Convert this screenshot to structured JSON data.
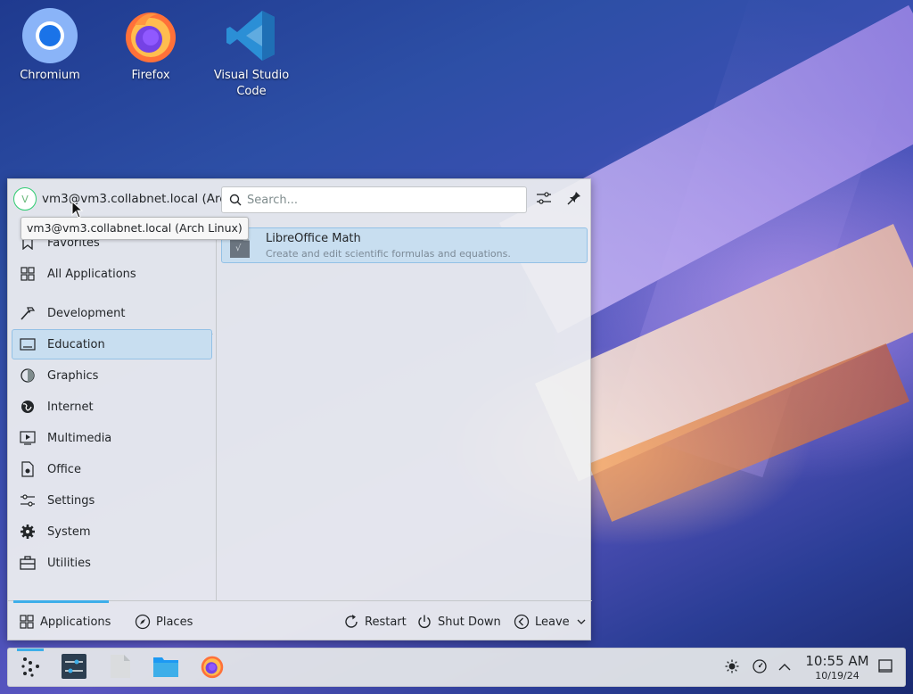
{
  "desktop": {
    "icons": [
      {
        "label": "Chromium",
        "icon": "chromium-icon"
      },
      {
        "label": "Firefox",
        "icon": "firefox-icon"
      },
      {
        "label": "Visual Studio Code",
        "icon": "vscode-icon"
      }
    ]
  },
  "launcher": {
    "avatar_letter": "V",
    "user_label": "vm3@vm3.collabnet.local (Arc...",
    "tooltip": "vm3@vm3.collabnet.local (Arch Linux)",
    "search": {
      "placeholder": "Search..."
    },
    "sidebar": {
      "items": [
        {
          "label": "Favorites",
          "icon": "bookmark-icon"
        },
        {
          "label": "All Applications",
          "icon": "grid-icon"
        },
        {
          "label": "Development",
          "icon": "hammer-icon"
        },
        {
          "label": "Education",
          "icon": "education-icon",
          "selected": true
        },
        {
          "label": "Graphics",
          "icon": "graphics-icon"
        },
        {
          "label": "Internet",
          "icon": "globe-icon"
        },
        {
          "label": "Multimedia",
          "icon": "multimedia-icon"
        },
        {
          "label": "Office",
          "icon": "office-icon"
        },
        {
          "label": "Settings",
          "icon": "settings-sliders-icon"
        },
        {
          "label": "System",
          "icon": "gear-icon"
        },
        {
          "label": "Utilities",
          "icon": "toolbox-icon"
        }
      ]
    },
    "results": [
      {
        "name": "LibreOffice Math",
        "description": "Create and edit scientific formulas and equations."
      }
    ],
    "footer": {
      "applications": "Applications",
      "places": "Places",
      "restart": "Restart",
      "shutdown": "Shut Down",
      "leave": "Leave"
    }
  },
  "taskbar": {
    "clock": {
      "time": "10:55 AM",
      "date": "10/19/24"
    }
  },
  "colors": {
    "accent": "#3daee9",
    "selection": "#c8def0",
    "panel": "#eff0f1"
  }
}
